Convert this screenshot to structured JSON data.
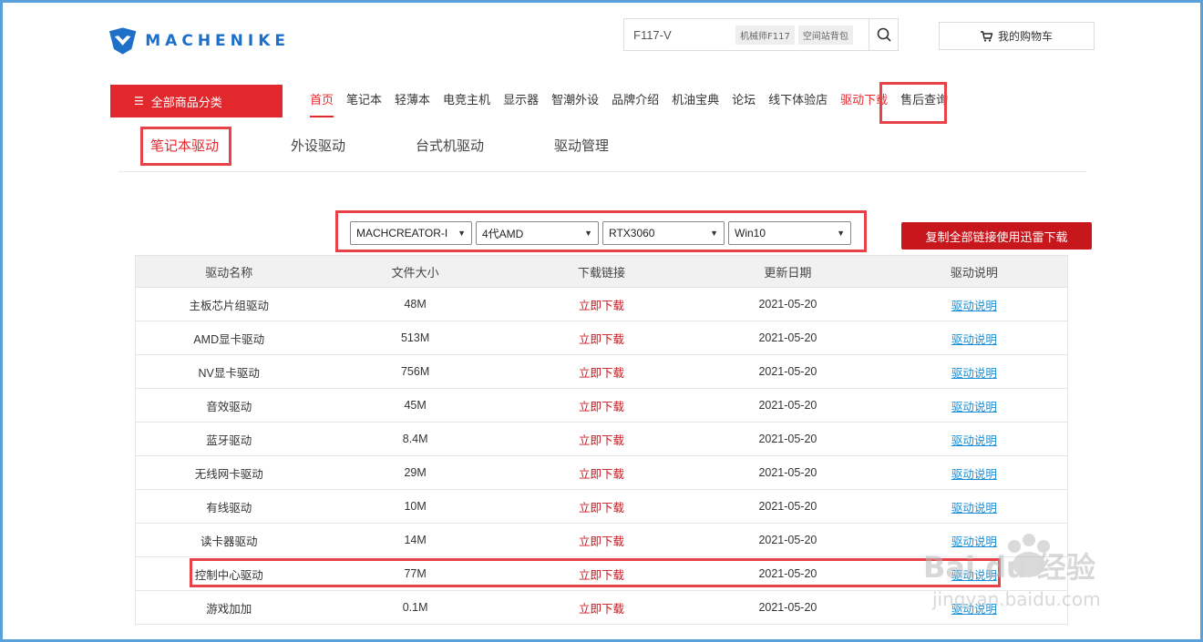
{
  "logo": {
    "text": "MACHENIKE"
  },
  "search": {
    "value": "F117-V",
    "hot_tags": [
      "机械师F117",
      "空间站背包"
    ]
  },
  "cart": {
    "label": "我的购物车"
  },
  "nav": {
    "all_categories": "全部商品分类",
    "items": [
      {
        "label": "首页",
        "active": true
      },
      {
        "label": "笔记本"
      },
      {
        "label": "轻薄本"
      },
      {
        "label": "电竞主机"
      },
      {
        "label": "显示器"
      },
      {
        "label": "智潮外设"
      },
      {
        "label": "品牌介绍"
      },
      {
        "label": "机油宝典"
      },
      {
        "label": "论坛"
      },
      {
        "label": "线下体验店"
      },
      {
        "label": "驱动下载"
      },
      {
        "label": "售后查询"
      }
    ]
  },
  "subtabs": [
    "笔记本驱动",
    "外设驱动",
    "台式机驱动",
    "驱动管理"
  ],
  "filters": {
    "model": "MACHCREATOR-I",
    "cpu": "4代AMD",
    "gpu": "RTX3060",
    "os": "Win10"
  },
  "copy_all_button": "复制全部链接使用迅雷下载",
  "table": {
    "headers": [
      "驱动名称",
      "文件大小",
      "下载链接",
      "更新日期",
      "驱动说明"
    ],
    "rows": [
      {
        "name": "主板芯片组驱动",
        "size": "48M",
        "link": "立即下载",
        "date": "2021-05-20",
        "doc": "驱动说明"
      },
      {
        "name": "AMD显卡驱动",
        "size": "513M",
        "link": "立即下载",
        "date": "2021-05-20",
        "doc": "驱动说明"
      },
      {
        "name": "NV显卡驱动",
        "size": "756M",
        "link": "立即下载",
        "date": "2021-05-20",
        "doc": "驱动说明"
      },
      {
        "name": "音效驱动",
        "size": "45M",
        "link": "立即下载",
        "date": "2021-05-20",
        "doc": "驱动说明"
      },
      {
        "name": "蓝牙驱动",
        "size": "8.4M",
        "link": "立即下载",
        "date": "2021-05-20",
        "doc": "驱动说明"
      },
      {
        "name": "无线网卡驱动",
        "size": "29M",
        "link": "立即下载",
        "date": "2021-05-20",
        "doc": "驱动说明"
      },
      {
        "name": "有线驱动",
        "size": "10M",
        "link": "立即下载",
        "date": "2021-05-20",
        "doc": "驱动说明"
      },
      {
        "name": "读卡器驱动",
        "size": "14M",
        "link": "立即下载",
        "date": "2021-05-20",
        "doc": "驱动说明"
      },
      {
        "name": "控制中心驱动",
        "size": "77M",
        "link": "立即下载",
        "date": "2021-05-20",
        "doc": "驱动说明"
      },
      {
        "name": "游戏加加",
        "size": "0.1M",
        "link": "立即下载",
        "date": "2021-05-20",
        "doc": "驱动说明"
      }
    ]
  },
  "watermark": {
    "brand": "Bai du 经验",
    "url": "jingyan.baidu.com"
  },
  "colors": {
    "brand_red": "#e2282d",
    "link_blue": "#1b8fd6",
    "highlight_box": "#e84148"
  }
}
